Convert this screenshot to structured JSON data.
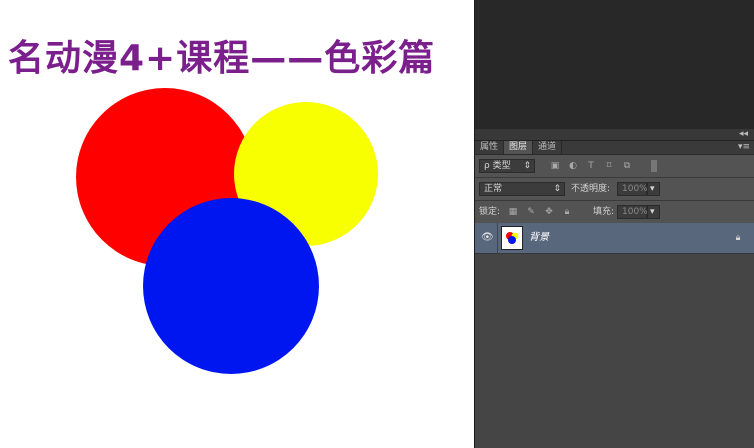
{
  "canvas": {
    "title": "名动漫4+课程——色彩篇",
    "title_color": "#7a1f8c",
    "circles": [
      {
        "name": "red",
        "color": "#ff0000"
      },
      {
        "name": "yellow",
        "color": "#f7ff00"
      },
      {
        "name": "blue",
        "color": "#0016f0"
      }
    ]
  },
  "panel": {
    "collapse_icon": "double-chevron-left-icon",
    "tabs": [
      {
        "label": "属性",
        "active": false
      },
      {
        "label": "图层",
        "active": true
      },
      {
        "label": "通道",
        "active": false
      }
    ],
    "menu_icon": "panel-menu-icon",
    "filter": {
      "label": "ρ 类型",
      "arrow": "⇕"
    },
    "blend": {
      "mode": "正常",
      "opacity_label": "不透明度:",
      "opacity_value": "100%"
    },
    "lock": {
      "label": "锁定:",
      "fill_label": "填充:",
      "fill_value": "100%"
    },
    "layer": {
      "name": "背景",
      "locked": true
    }
  }
}
